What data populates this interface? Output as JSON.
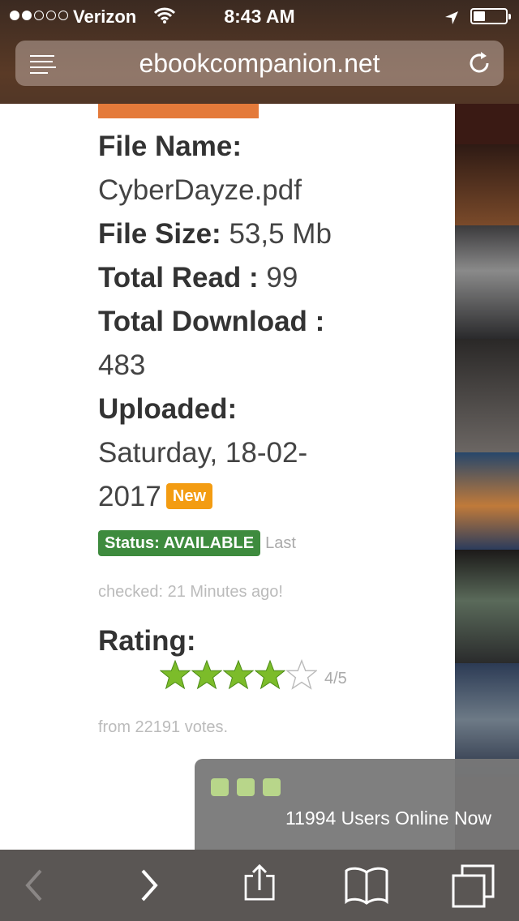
{
  "status_bar": {
    "carrier": "Verizon",
    "time": "8:43 AM",
    "signal_bars": 2,
    "signal_total": 5,
    "battery_level": 0.25
  },
  "url_bar": {
    "url": "ebookcompanion.net"
  },
  "file": {
    "name_label": "File Name:",
    "name_value": "CyberDayze.pdf",
    "size_label": "File Size:",
    "size_value": " 53,5 Mb",
    "read_label": "Total Read :",
    "read_value": " 99",
    "download_label": "Total Download :",
    "download_value": "483",
    "uploaded_label": "Uploaded:",
    "uploaded_value_line1": "Saturday, 18-02-",
    "uploaded_value_line2": "2017",
    "new_badge": "New",
    "status_badge": "Status: AVAILABLE",
    "status_last": "Last",
    "status_checked": "checked: 21 Minutes ago!",
    "rating_label": "Rating:",
    "rating_value": 4,
    "rating_max": 5,
    "rating_text": "4/5",
    "votes": "from 22191 votes."
  },
  "online": {
    "text": "11994 Users Online Now"
  },
  "colors": {
    "accent_new": "#f39c12",
    "status_green": "#3e8b3e",
    "star_green": "#7cbc2a"
  },
  "toolbar": {
    "icons": [
      "back-icon",
      "forward-icon",
      "share-icon",
      "bookmarks-icon",
      "tabs-icon"
    ]
  }
}
